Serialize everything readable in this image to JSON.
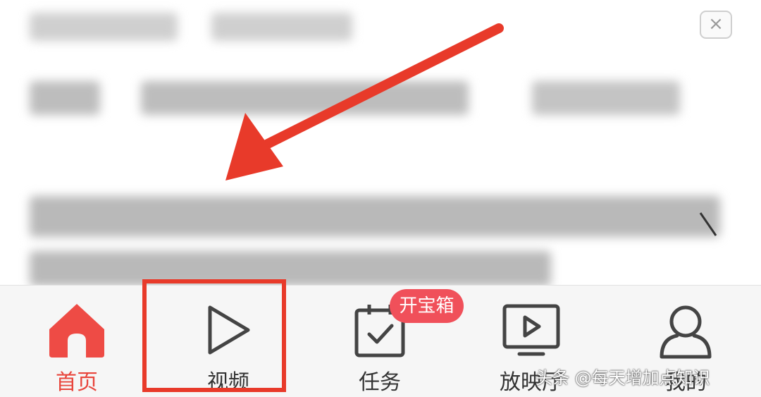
{
  "overlay": {
    "close_symbol": "×"
  },
  "tabbar": {
    "accent_color": "#e8453c",
    "tabs": [
      {
        "label": "首页",
        "icon": "home-icon",
        "active": true
      },
      {
        "label": "视频",
        "icon": "play-icon",
        "active": false
      },
      {
        "label": "任务",
        "icon": "task-calendar-icon",
        "active": false,
        "badge": "开宝箱"
      },
      {
        "label": "放映厅",
        "icon": "screen-play-icon",
        "active": false
      },
      {
        "label": "我的",
        "icon": "person-icon",
        "active": false
      }
    ]
  },
  "annotation": {
    "arrow_color": "#e83a2a",
    "highlight_color": "#e83a2a"
  },
  "watermark": "头条 @每天增加点知识"
}
